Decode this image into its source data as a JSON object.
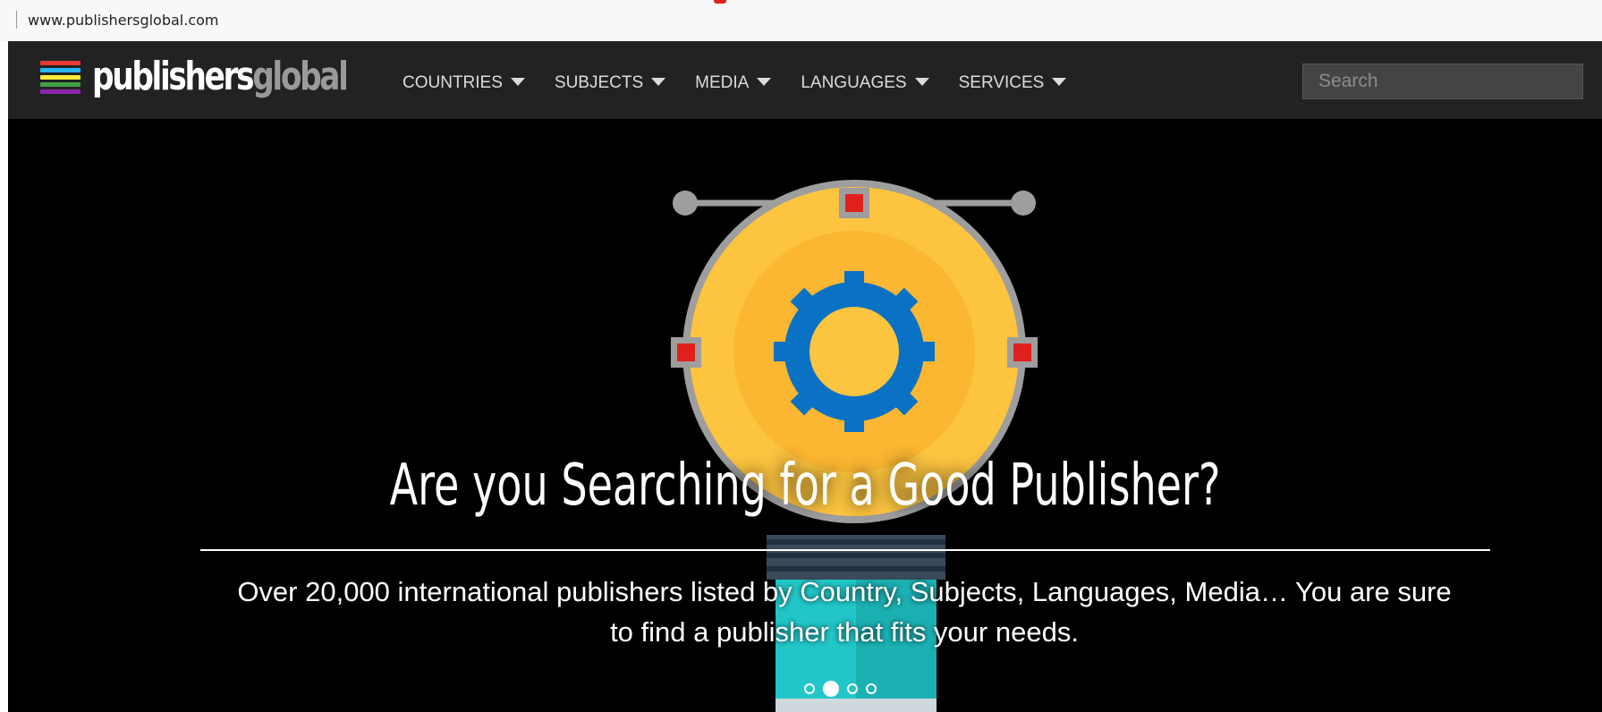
{
  "browser": {
    "url": "www.publishersglobal.com"
  },
  "logo": {
    "part1": "publishers",
    "part2": "global"
  },
  "nav": {
    "items": [
      {
        "label": "COUNTRIES"
      },
      {
        "label": "SUBJECTS"
      },
      {
        "label": "MEDIA"
      },
      {
        "label": "LANGUAGES"
      },
      {
        "label": "SERVICES"
      }
    ]
  },
  "search": {
    "placeholder": "Search",
    "value": ""
  },
  "hero": {
    "headline": "Are you Searching for a Good Publisher?",
    "subtext": "Over 20,000 international publishers listed by Country, Subjects, Languages, Media… You are sure to find a publisher that fits your needs.",
    "slides_total": 4,
    "slide_active": 2
  },
  "colors": {
    "navbar_bg": "#222222",
    "hero_bg": "#000000",
    "bulb_yellow": "#fdc43f",
    "gear_blue": "#0a72c4",
    "accent_red": "#e0201c",
    "pencil_teal": "#22c6c8",
    "logo_stripes": [
      "#e53935",
      "#29b6f6",
      "#ffeb3b",
      "#43a047",
      "#8e24aa"
    ]
  }
}
